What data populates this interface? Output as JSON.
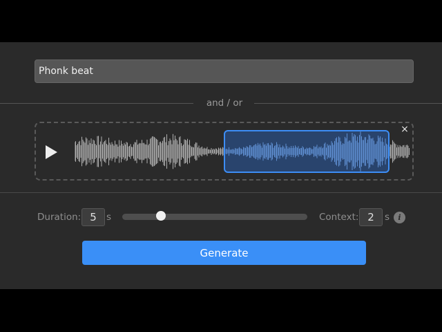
{
  "prompt": {
    "value": "Phonk beat"
  },
  "divider": {
    "text": "and / or"
  },
  "audio": {
    "close_label": "×",
    "selection_fraction": [
      0.445,
      0.94
    ]
  },
  "controls": {
    "duration_label": "Duration:",
    "duration_value": "5",
    "duration_unit": "s",
    "slider_fraction": 0.21,
    "context_label": "Context:",
    "context_value": "2",
    "context_unit": "s",
    "info_glyph": "i"
  },
  "generate": {
    "label": "Generate"
  },
  "colors": {
    "accent": "#3a8ff7",
    "panel": "#2a2a2a",
    "waveform": "#b0b0b0",
    "waveform_selected": "#8fb4e4"
  },
  "icons": [
    "play-icon",
    "close-icon",
    "info-icon"
  ]
}
